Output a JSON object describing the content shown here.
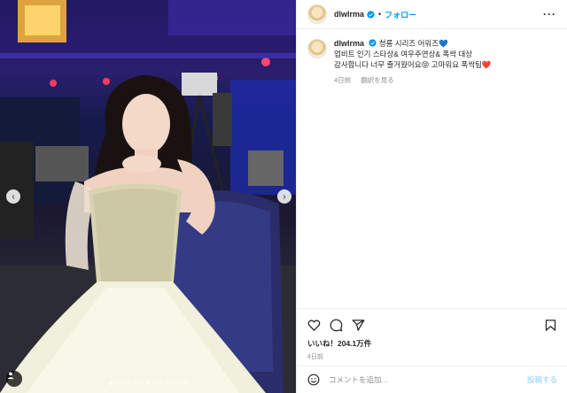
{
  "post": {
    "username": "dlwlrma",
    "follow_label": "フォロー",
    "separator": "•",
    "more_label": "···",
    "caption_lines": [
      "청룡 시리즈 어워즈💙",
      "업비트 인기 스타상& 여우주연상& 폭싹 대상",
      "감사합니다 너무 즐거웠어요😝 고마워요 폭싹팀❤️"
    ],
    "caption_time": "4日前",
    "see_translation": "翻訳を見る",
    "likes": "いいね！204.1万件",
    "date": "4日前",
    "comment_placeholder": "コメントを追加...",
    "post_button": "投稿する"
  },
  "carousel": {
    "prev_icon": "chevron-left-icon",
    "next_icon": "chevron-right-icon",
    "slide_count": 13,
    "active_index": 0
  },
  "colors": {
    "accent": "#0095f6",
    "verified": "#0095f6",
    "post_button_disabled": "#b2dffc",
    "muted": "#8e8e8e"
  }
}
